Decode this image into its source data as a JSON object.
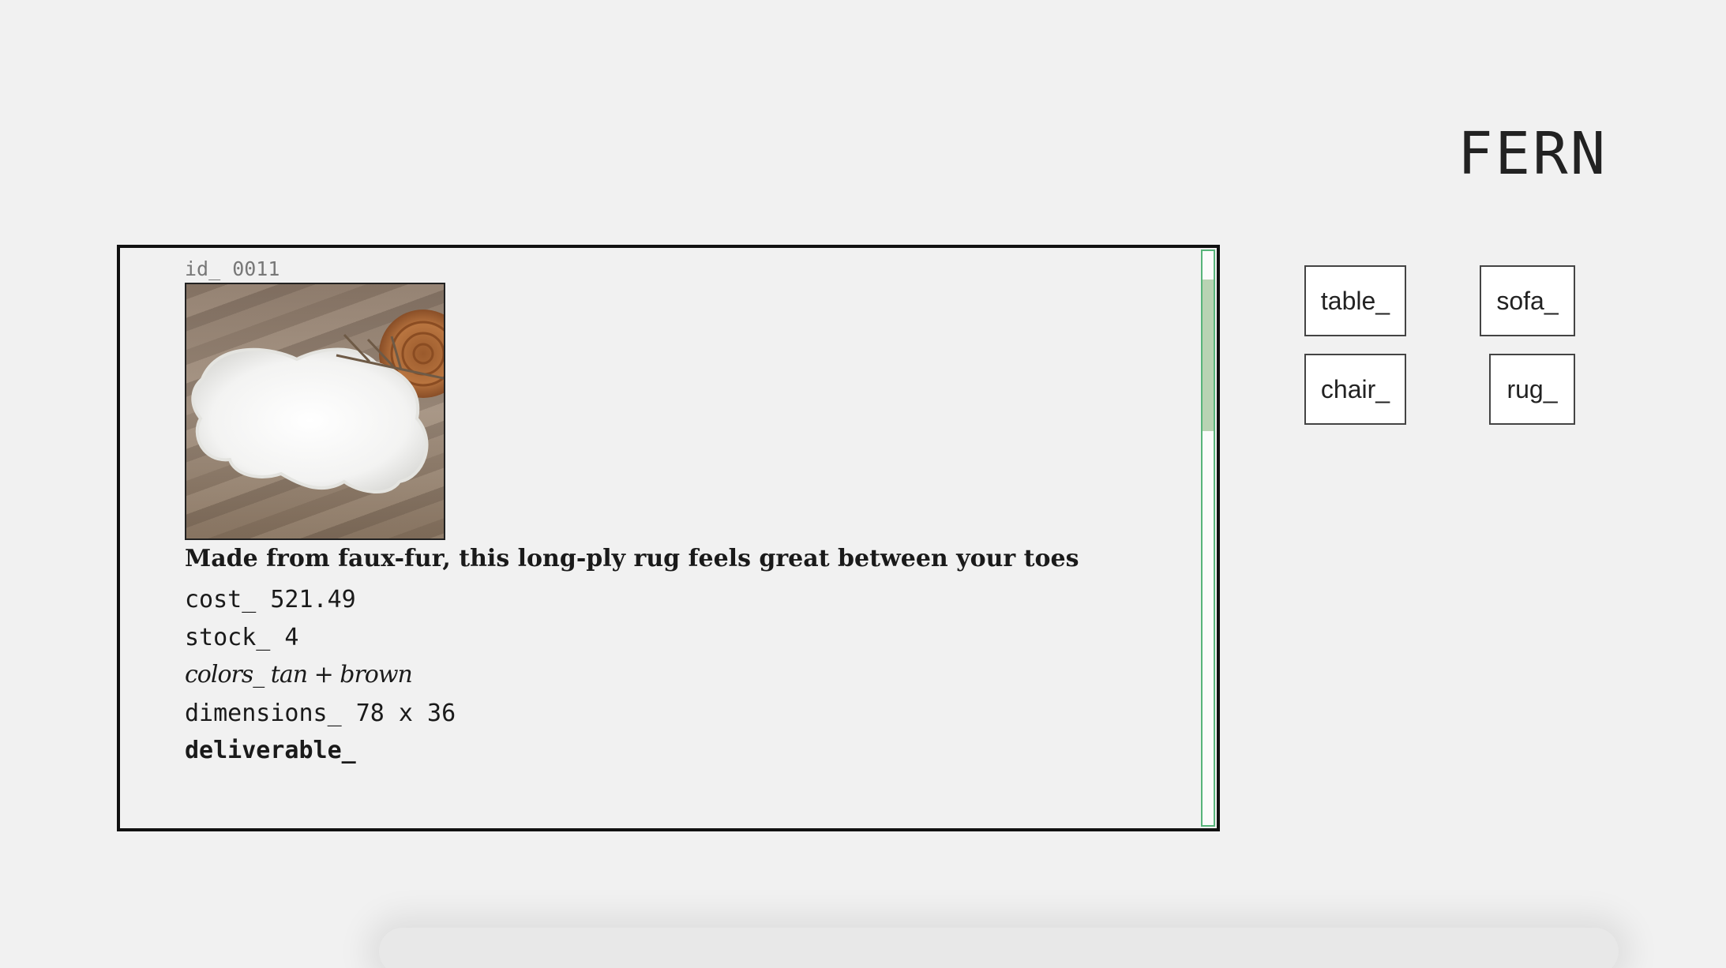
{
  "brand": {
    "logo": "FERN"
  },
  "product": {
    "id_text": "id_ 0011",
    "image_icon": "faux-fur-rug-photo",
    "description": "Made from faux-fur, this long-ply rug feels great between your toes",
    "cost": "cost_ 521.49",
    "stock": "stock_ 4",
    "colors": "colors_ tan + brown",
    "dimensions": "dimensions_ 78 x 36",
    "deliverable": "deliverable_"
  },
  "categories": {
    "table": "table_",
    "sofa": "sofa_",
    "chair": "chair_",
    "rug": "rug_"
  },
  "colors": {
    "background": "#f1f1f1",
    "scrollbar_border": "#57b47a",
    "scrollbar_thumb": "#b8d3b3"
  }
}
